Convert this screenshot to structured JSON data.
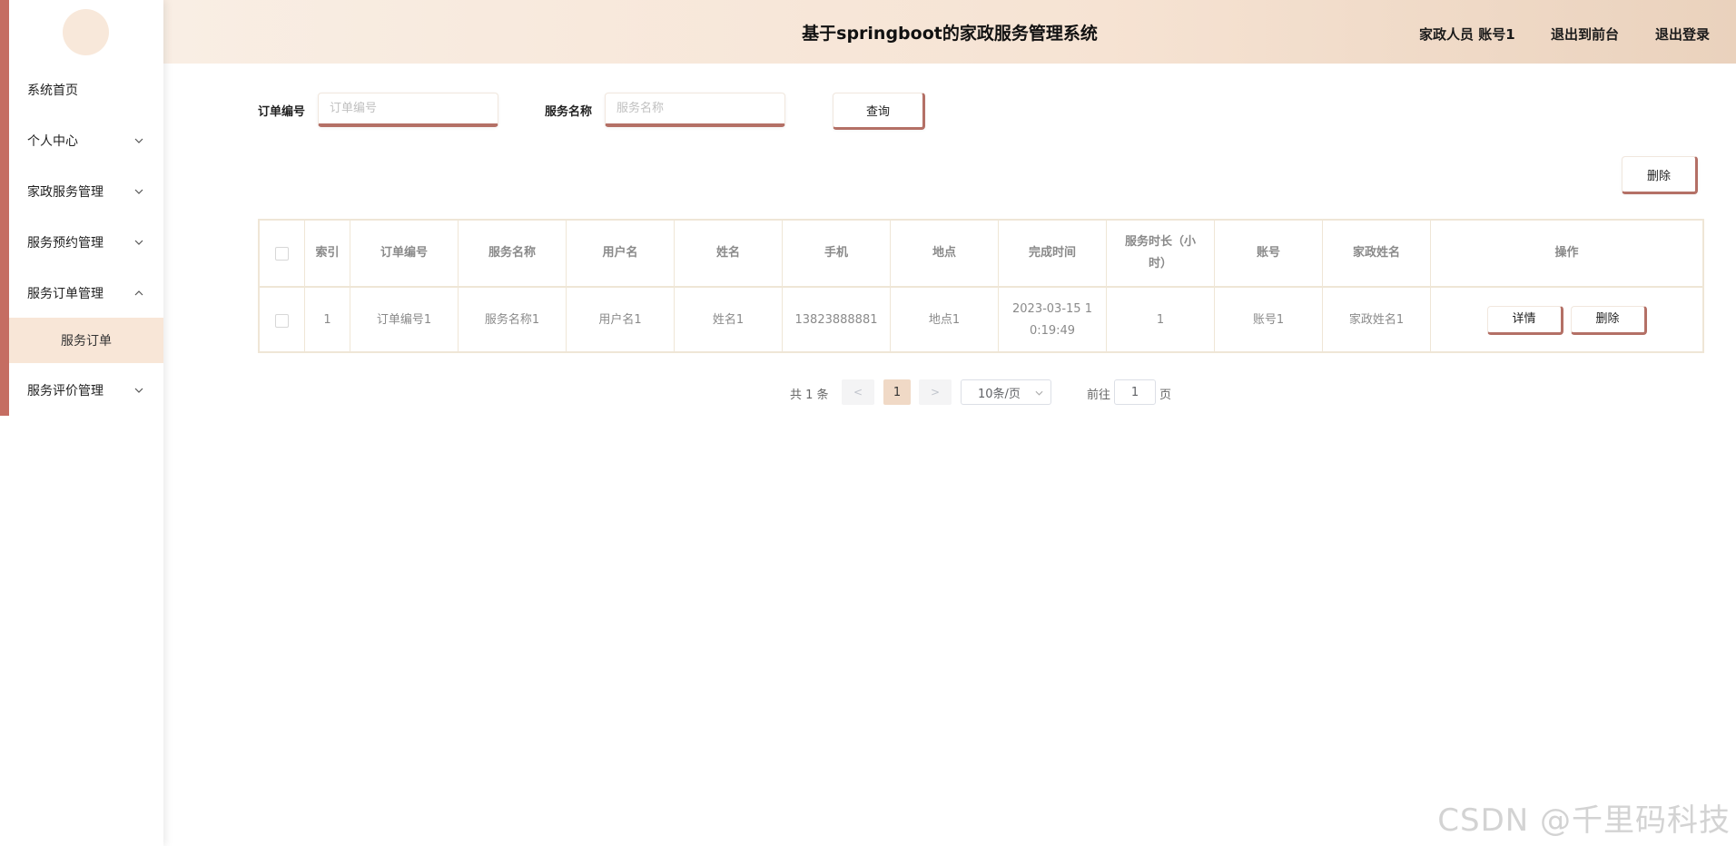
{
  "header": {
    "title": "基于springboot的家政服务管理系统",
    "user": "家政人员 账号1",
    "front_link": "退出到前台",
    "logout_link": "退出登录"
  },
  "sidebar": {
    "items": [
      {
        "label": "系统首页",
        "chevron": "none"
      },
      {
        "label": "个人中心",
        "chevron": "down"
      },
      {
        "label": "家政服务管理",
        "chevron": "down"
      },
      {
        "label": "服务预约管理",
        "chevron": "down"
      },
      {
        "label": "服务订单管理",
        "chevron": "up"
      },
      {
        "label": "服务评价管理",
        "chevron": "down"
      }
    ],
    "active_sub": "服务订单"
  },
  "search": {
    "order_no_label": "订单编号",
    "order_no_placeholder": "订单编号",
    "service_name_label": "服务名称",
    "service_name_placeholder": "服务名称",
    "query_button": "查询"
  },
  "toolbar": {
    "delete_button": "删除"
  },
  "table": {
    "columns": [
      "索引",
      "订单编号",
      "服务名称",
      "用户名",
      "姓名",
      "手机",
      "地点",
      "完成时间",
      "服务时长（小时）",
      "账号",
      "家政姓名",
      "操作"
    ],
    "rows": [
      {
        "index": "1",
        "order_no": "订单编号1",
        "service_name": "服务名称1",
        "username": "用户名1",
        "name": "姓名1",
        "phone": "13823888881",
        "location": "地点1",
        "finish_time": "2023-03-15 10:19:49",
        "duration": "1",
        "account": "账号1",
        "staff_name": "家政姓名1",
        "detail_button": "详情",
        "delete_button": "删除"
      }
    ]
  },
  "pagination": {
    "total": "共 1 条",
    "prev": "<",
    "current_page": "1",
    "next": ">",
    "page_size": "10条/页",
    "goto_label": "前往",
    "goto_value": "1",
    "page_unit": "页"
  },
  "watermark": "CSDN @千里码科技",
  "colors": {
    "accent": "#c56d62",
    "button_shadow": "#b47066",
    "active_bg": "#f8e6d7",
    "header_start": "#f9eee4",
    "header_end": "#ead2bd"
  }
}
